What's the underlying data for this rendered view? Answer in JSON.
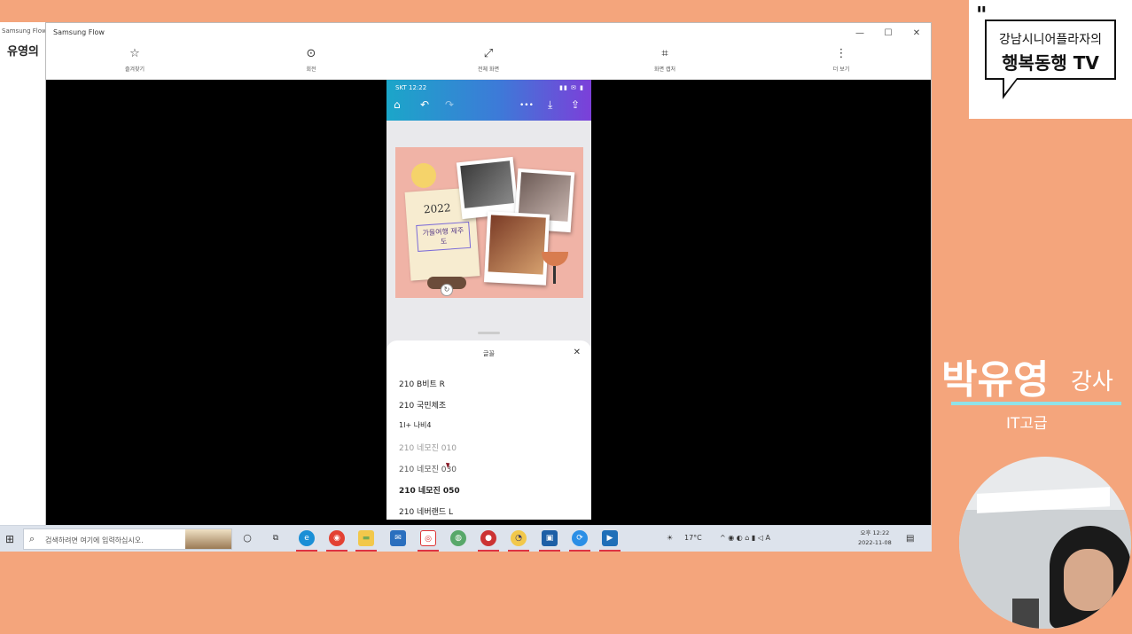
{
  "back_window": {
    "title": "Samsung Flow",
    "heading": "유영의"
  },
  "flow_window": {
    "title": "Samsung Flow",
    "controls": {
      "minimize": "—",
      "maximize": "☐",
      "close": "✕"
    },
    "toolbar": [
      {
        "icon": "star-icon",
        "glyph": "☆",
        "label": "즐겨찾기"
      },
      {
        "icon": "rotate-icon",
        "glyph": "⊙",
        "label": "회전"
      },
      {
        "icon": "fullscreen-icon",
        "glyph": "⤢",
        "label": "전체 화면"
      },
      {
        "icon": "capture-icon",
        "glyph": "⌗",
        "label": "화면 캡처"
      },
      {
        "icon": "more-icon",
        "glyph": "⋮",
        "label": "더 보기"
      }
    ]
  },
  "phone": {
    "status_left": "SKT 12:22",
    "status_right": "▮▮ ✉ ▮",
    "nav": {
      "home": "⌂",
      "undo": "↶",
      "redo": "↷",
      "more": "•••",
      "download": "⤓",
      "share": "⇪"
    },
    "design": {
      "year": "2022",
      "caption": "가을여행 제주도"
    },
    "sheet": {
      "title": "글꼴",
      "close": "✕",
      "fonts": [
        {
          "label": "210 B비트 R",
          "style": "normal"
        },
        {
          "label": "210 국민체조",
          "style": "normal"
        },
        {
          "label": "1I+ 나비4",
          "style": "normal"
        },
        {
          "label": "210 네모진 010",
          "style": "light"
        },
        {
          "label": "210 네모진 030",
          "style": "normal"
        },
        {
          "label": "210 네모진 050",
          "style": "normal"
        },
        {
          "label": "210 네버랜드 L",
          "style": "normal"
        }
      ]
    }
  },
  "taskbar": {
    "search_placeholder": "검색하려면 여기에 입력하십시오.",
    "weather": "17°C",
    "clock_time": "오후 12:22",
    "clock_date": "2022-11-08",
    "tray_text": "^ ◉ ◐ ⌂ ▮ ◁ A"
  },
  "branding": {
    "line1": "강남시니어플라자의",
    "line2": "행복동행 TV"
  },
  "instructor": {
    "name": "박유영",
    "title": "강사",
    "subtitle": "IT고급"
  },
  "colors": {
    "background": "#f4a57c",
    "accent_line": "#8fe2e8",
    "phone_gradient_start": "#1ba6c9",
    "phone_gradient_end": "#7c3fd9"
  }
}
